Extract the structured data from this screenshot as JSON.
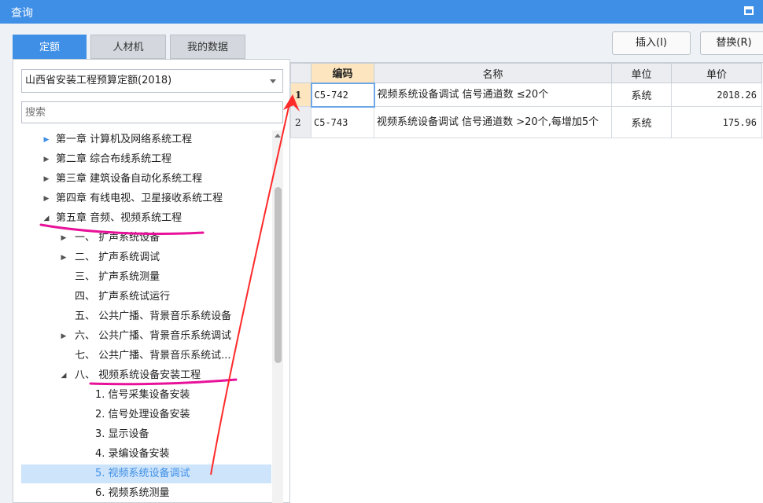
{
  "window": {
    "title": "查询"
  },
  "tabs": [
    {
      "label": "定额",
      "active": true
    },
    {
      "label": "人材机",
      "active": false
    },
    {
      "label": "我的数据",
      "active": false
    }
  ],
  "toolbar": {
    "insert_label": "插入(I)",
    "replace_label": "替换(R)"
  },
  "library_select": {
    "value": "山西省安装工程预算定额(2018)"
  },
  "search": {
    "placeholder": "搜索"
  },
  "tree": [
    {
      "label": "第一章 计算机及网络系统工程",
      "toggle": "collapsed"
    },
    {
      "label": "第二章 综合布线系统工程",
      "toggle": "collapsed"
    },
    {
      "label": "第三章 建筑设备自动化系统工程",
      "toggle": "collapsed"
    },
    {
      "label": "第四章 有线电视、卫星接收系统工程",
      "toggle": "collapsed"
    },
    {
      "label": "第五章 音频、视频系统工程",
      "toggle": "expanded"
    },
    {
      "label": "一、 扩声系统设备",
      "toggle": "collapsed"
    },
    {
      "label": "二、 扩声系统调试",
      "toggle": "collapsed"
    },
    {
      "label": "三、 扩声系统测量",
      "toggle": "none"
    },
    {
      "label": "四、 扩声系统试运行",
      "toggle": "none"
    },
    {
      "label": "五、 公共广播、背景音乐系统设备",
      "toggle": "none"
    },
    {
      "label": "六、 公共广播、背景音乐系统调试",
      "toggle": "collapsed"
    },
    {
      "label": "七、 公共广播、背景音乐系统试...",
      "toggle": "none"
    },
    {
      "label": "八、 视频系统设备安装工程",
      "toggle": "expanded"
    },
    {
      "label": "1. 信号采集设备安装",
      "toggle": "none"
    },
    {
      "label": "2. 信号处理设备安装",
      "toggle": "none"
    },
    {
      "label": "3. 显示设备",
      "toggle": "none"
    },
    {
      "label": "4. 录编设备安装",
      "toggle": "none"
    },
    {
      "label": "5. 视频系统设备调试",
      "toggle": "none",
      "selected": true
    },
    {
      "label": "6. 视频系统测量",
      "toggle": "none"
    }
  ],
  "table": {
    "headers": [
      "编码",
      "名称",
      "单位",
      "单价"
    ],
    "rows": [
      {
        "num": "1",
        "code": "C5-742",
        "name": "视频系统设备调试 信号通道数 ≤20个",
        "unit": "系统",
        "price": "2018.26"
      },
      {
        "num": "2",
        "code": "C5-743",
        "name": "视频系统设备调试 信号通道数 >20个,每增加5个",
        "unit": "系统",
        "price": "175.96"
      }
    ]
  },
  "annotation_color": "#e8129a",
  "arrow_color": "#ff2a2a"
}
